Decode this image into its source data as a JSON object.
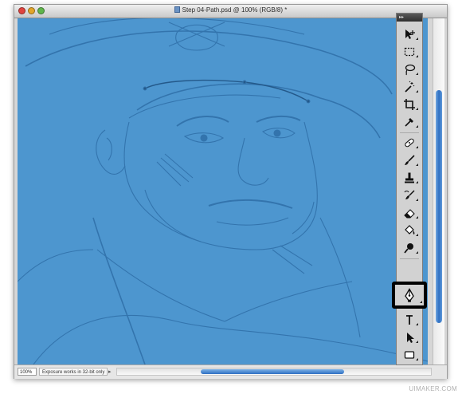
{
  "window": {
    "title": "Step 04-Path.psd @ 100% (RGB/8) *"
  },
  "status": {
    "zoom": "100%",
    "message": "Exposure works in 32-bit only",
    "arrow": "▸"
  },
  "tools_panel": {
    "header": "▸▸",
    "tools": [
      {
        "name": "move-tool",
        "icon": "move-icon",
        "selected": false
      },
      {
        "name": "marquee-tool",
        "icon": "marquee-icon",
        "selected": false
      },
      {
        "name": "lasso-tool",
        "icon": "lasso-icon",
        "selected": false
      },
      {
        "name": "magic-wand-tool",
        "icon": "magic-wand-icon",
        "selected": false
      },
      {
        "name": "crop-tool",
        "icon": "crop-icon",
        "selected": false
      },
      {
        "name": "eyedropper-tool",
        "icon": "eyedropper-icon",
        "selected": false
      },
      {
        "name": "healing-brush-tool",
        "icon": "bandage-icon",
        "selected": false
      },
      {
        "name": "brush-tool",
        "icon": "brush-icon",
        "selected": false
      },
      {
        "name": "clone-stamp-tool",
        "icon": "stamp-icon",
        "selected": false
      },
      {
        "name": "history-brush-tool",
        "icon": "history-brush-icon",
        "selected": false
      },
      {
        "name": "eraser-tool",
        "icon": "eraser-icon",
        "selected": false
      },
      {
        "name": "paint-bucket-tool",
        "icon": "bucket-icon",
        "selected": false
      },
      {
        "name": "dodge-tool",
        "icon": "dodge-icon",
        "selected": false
      },
      {
        "name": "pen-tool",
        "icon": "pen-icon",
        "selected": true
      },
      {
        "name": "type-tool",
        "icon": "type-icon",
        "selected": false
      },
      {
        "name": "path-selection-tool",
        "icon": "arrow-icon",
        "selected": false
      },
      {
        "name": "shape-tool",
        "icon": "rectangle-icon",
        "selected": false
      }
    ]
  },
  "colors": {
    "canvas_blue": "#4d96cf",
    "line_art": "#2f6fa8",
    "scroll_accent": "#2f6fc2"
  },
  "watermark": "UIMAKER.COM"
}
